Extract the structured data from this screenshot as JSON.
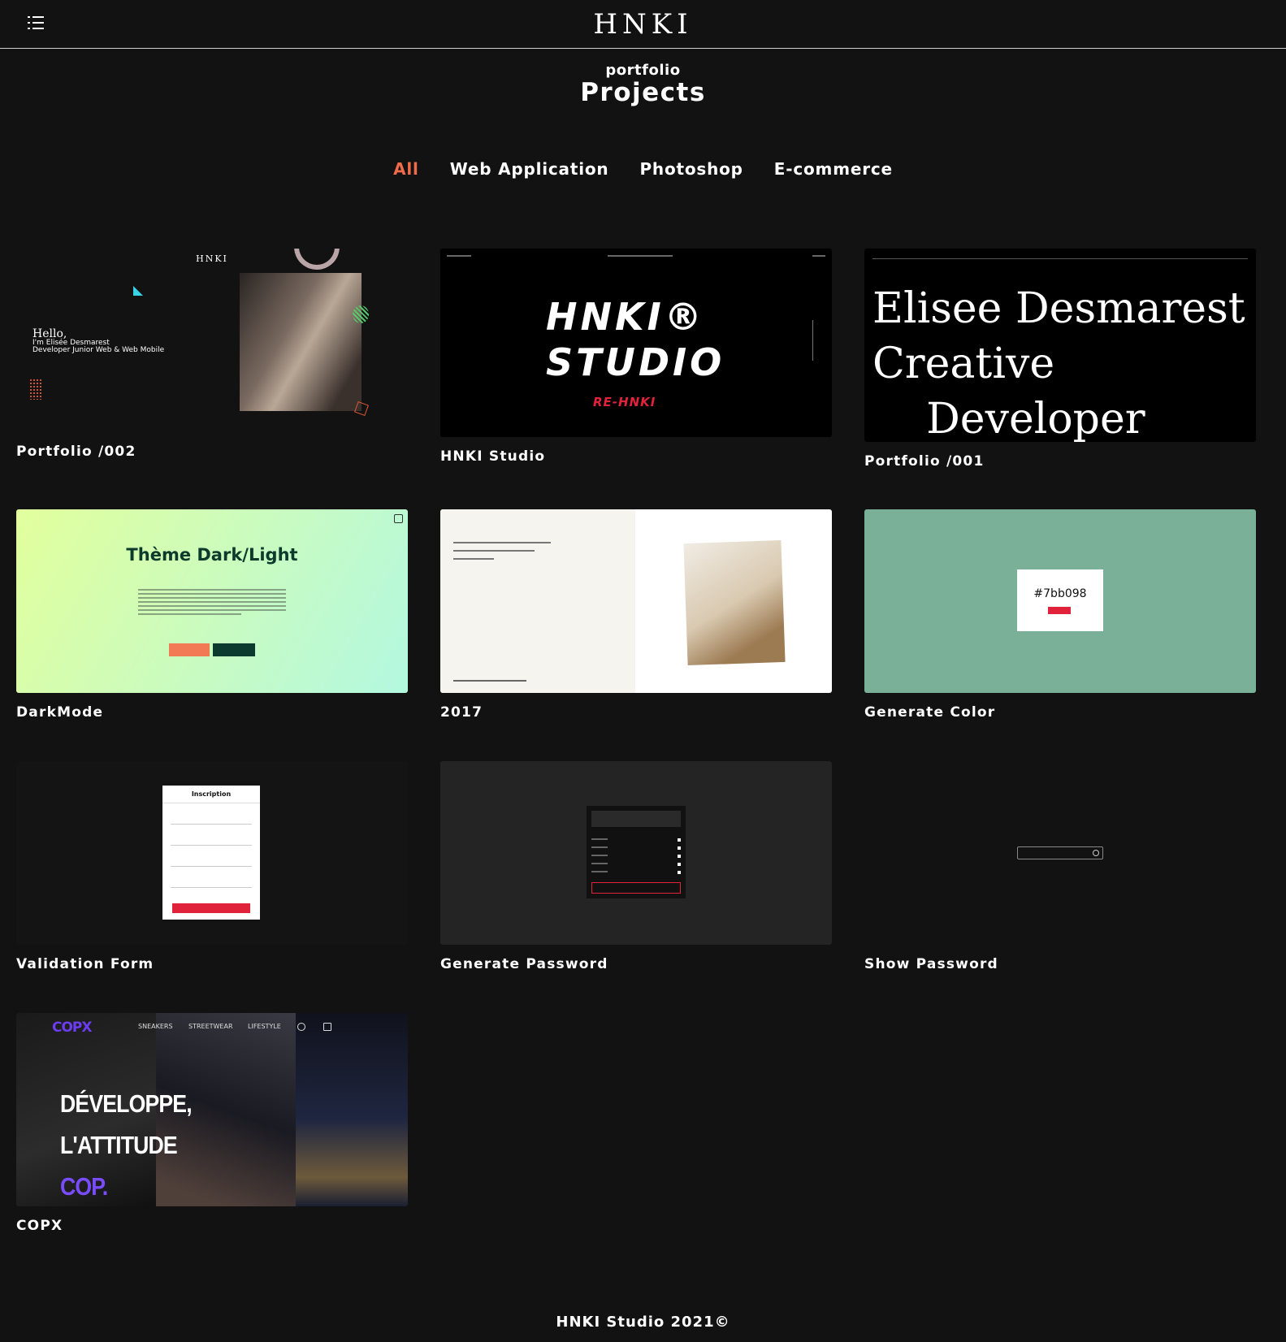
{
  "header": {
    "logo": "HNKI",
    "menu_icon": "menu-icon"
  },
  "section": {
    "kicker": "portfolio",
    "title": "Projects"
  },
  "filters": [
    {
      "label": "All",
      "active": true
    },
    {
      "label": "Web Application",
      "active": false
    },
    {
      "label": "Photoshop",
      "active": false
    },
    {
      "label": "E-commerce",
      "active": false
    }
  ],
  "projects": [
    {
      "title": "Portfolio /002",
      "thumb": {
        "logo": "HNKI",
        "hello": "Hello,",
        "line1": "I'm Elisée Desmarest",
        "line2": "Developer Junior Web & Web Mobile"
      }
    },
    {
      "title": "HNKI Studio",
      "thumb": {
        "line1": "HNKI®",
        "line2": "STUDIO",
        "tag": "RE-HNKI"
      }
    },
    {
      "title": "Portfolio /001",
      "thumb": {
        "text": "Elisee Desmarest\nCreative\n    Developer"
      }
    },
    {
      "title": "DarkMode",
      "thumb": {
        "heading": "Thème Dark/Light"
      }
    },
    {
      "title": "2017",
      "thumb": {}
    },
    {
      "title": "Generate Color",
      "thumb": {
        "hex": "#7bb098"
      }
    },
    {
      "title": "Validation Form",
      "thumb": {
        "heading": "Inscription"
      }
    },
    {
      "title": "Generate Password",
      "thumb": {}
    },
    {
      "title": "Show Password",
      "thumb": {}
    },
    {
      "title": "COPX",
      "thumb": {
        "brand": "COPX",
        "nav": [
          "SNEAKERS",
          "STREETWEAR",
          "LIFESTYLE"
        ],
        "line1": "DÉVELOPPE,",
        "line2": "L'ATTITUDE",
        "line3": "COP."
      }
    }
  ],
  "footer": {
    "text": "HNKI Studio 2021©"
  },
  "colors": {
    "background": "#121212",
    "accent": "#f06b4a",
    "text": "#ffffff"
  }
}
